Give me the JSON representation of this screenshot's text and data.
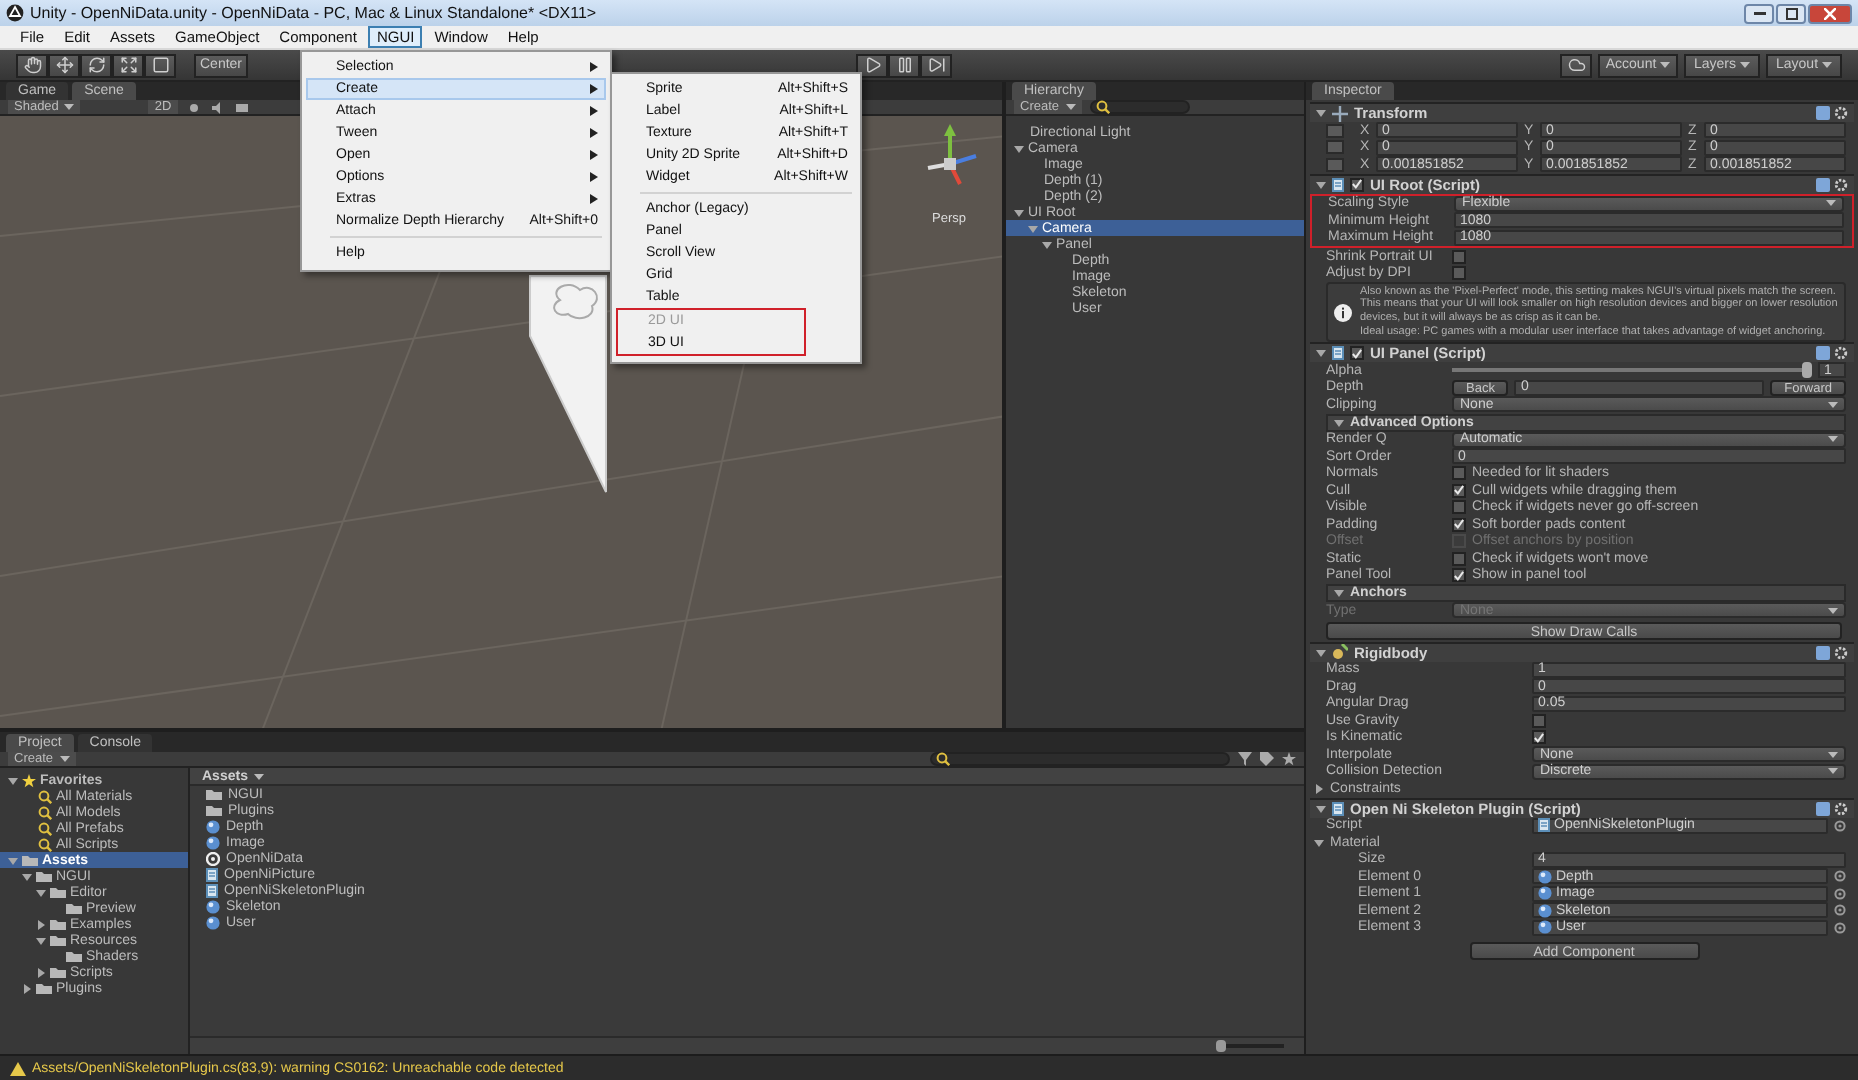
{
  "window": {
    "title": "Unity - OpenNiData.unity - OpenNiData - PC, Mac & Linux Standalone* <DX11>"
  },
  "menubar": [
    {
      "label": "File",
      "selected": false
    },
    {
      "label": "Edit",
      "selected": false
    },
    {
      "label": "Assets",
      "selected": false
    },
    {
      "label": "GameObject",
      "selected": false
    },
    {
      "label": "Component",
      "selected": false
    },
    {
      "label": "NGUI",
      "selected": true
    },
    {
      "label": "Window",
      "selected": false
    },
    {
      "label": "Help",
      "selected": false
    }
  ],
  "ngui_menu": {
    "items": [
      {
        "kind": "item",
        "label": "Selection",
        "submenu": true,
        "selected": false
      },
      {
        "kind": "item",
        "label": "Create",
        "submenu": true,
        "selected": true
      },
      {
        "kind": "item",
        "label": "Attach",
        "submenu": true,
        "selected": false
      },
      {
        "kind": "item",
        "label": "Tween",
        "submenu": true,
        "selected": false
      },
      {
        "kind": "item",
        "label": "Open",
        "submenu": true,
        "selected": false
      },
      {
        "kind": "item",
        "label": "Options",
        "submenu": true,
        "selected": false
      },
      {
        "kind": "item",
        "label": "Extras",
        "submenu": true,
        "selected": false
      },
      {
        "kind": "item",
        "label": "Normalize Depth Hierarchy",
        "shortcut": "Alt+Shift+0",
        "submenu": false,
        "selected": false
      },
      {
        "kind": "separator"
      },
      {
        "kind": "item",
        "label": "Help",
        "submenu": false,
        "selected": false
      }
    ]
  },
  "create_submenu": {
    "items": [
      {
        "kind": "item",
        "label": "Sprite",
        "shortcut": "Alt+Shift+S",
        "disabled": false,
        "marked": false
      },
      {
        "kind": "item",
        "label": "Label",
        "shortcut": "Alt+Shift+L",
        "disabled": false,
        "marked": false
      },
      {
        "kind": "item",
        "label": "Texture",
        "shortcut": "Alt+Shift+T",
        "disabled": false,
        "marked": false
      },
      {
        "kind": "item",
        "label": "Unity 2D Sprite",
        "shortcut": "Alt+Shift+D",
        "disabled": false,
        "marked": false
      },
      {
        "kind": "item",
        "label": "Widget",
        "shortcut": "Alt+Shift+W",
        "disabled": false,
        "marked": false
      },
      {
        "kind": "separator"
      },
      {
        "kind": "item",
        "label": "Anchor (Legacy)",
        "disabled": false,
        "marked": false
      },
      {
        "kind": "item",
        "label": "Panel",
        "disabled": false,
        "marked": false
      },
      {
        "kind": "item",
        "label": "Scroll View",
        "disabled": false,
        "marked": false
      },
      {
        "kind": "item",
        "label": "Grid",
        "disabled": false,
        "marked": false
      },
      {
        "kind": "item",
        "label": "Table",
        "disabled": false,
        "marked": false
      },
      {
        "kind": "item",
        "label": "2D UI",
        "disabled": true,
        "marked": true
      },
      {
        "kind": "item",
        "label": "3D UI",
        "disabled": false,
        "marked": true
      }
    ]
  },
  "toolbar": {
    "pivot": "Center",
    "account": "Account",
    "layers": "Layers",
    "layout": "Layout"
  },
  "scene_panel": {
    "tabs": [
      {
        "label": "Game",
        "selected": false
      },
      {
        "label": "Scene",
        "selected": true
      }
    ],
    "shading": "Shaded",
    "mode": "2D",
    "gizmo_label": "Persp"
  },
  "hierarchy": {
    "title": "Hierarchy",
    "create": "Create",
    "items": [
      {
        "label": "Directional Light",
        "selected": false
      },
      {
        "label": "Camera",
        "selected": false,
        "expanded": true,
        "children": [
          {
            "label": "Image",
            "selected": false
          },
          {
            "label": "Depth (1)",
            "selected": false
          },
          {
            "label": "Depth (2)",
            "selected": false
          }
        ]
      },
      {
        "label": "UI Root",
        "selected": false,
        "expanded": true,
        "children": [
          {
            "label": "Camera",
            "selected": true,
            "expanded": true,
            "children": [
              {
                "label": "Panel",
                "selected": false,
                "expanded": true,
                "children": [
                  {
                    "label": "Depth",
                    "selected": false
                  },
                  {
                    "label": "Image",
                    "selected": false
                  },
                  {
                    "label": "Skeleton",
                    "selected": false
                  },
                  {
                    "label": "User",
                    "selected": false
                  }
                ]
              }
            ]
          }
        ]
      }
    ]
  },
  "project": {
    "tabs": [
      {
        "label": "Project",
        "selected": true
      },
      {
        "label": "Console",
        "selected": false
      }
    ],
    "create": "Create",
    "tree": [
      {
        "kind": "favorites",
        "label": "Favorites",
        "selected": false,
        "expanded": true,
        "children": [
          {
            "kind": "search",
            "label": "All Materials",
            "selected": false
          },
          {
            "kind": "search",
            "label": "All Models",
            "selected": false
          },
          {
            "kind": "search",
            "label": "All Prefabs",
            "selected": false
          },
          {
            "kind": "search",
            "label": "All Scripts",
            "selected": false
          }
        ]
      },
      {
        "kind": "folder",
        "label": "Assets",
        "selected": true,
        "expanded": true,
        "children": [
          {
            "kind": "folder",
            "label": "NGUI",
            "selected": false,
            "expanded": true,
            "children": [
              {
                "kind": "folder",
                "label": "Editor",
                "selected": false,
                "expanded": true,
                "children": [
                  {
                    "kind": "folder",
                    "label": "Preview",
                    "selected": false
                  }
                ]
              },
              {
                "kind": "folder",
                "label": "Examples",
                "selected": false,
                "expanded": false
              },
              {
                "kind": "folder",
                "label": "Resources",
                "selected": false,
                "expanded": true,
                "children": [
                  {
                    "kind": "folder",
                    "label": "Shaders",
                    "selected": false
                  }
                ]
              },
              {
                "kind": "folder",
                "label": "Scripts",
                "selected": false,
                "expanded": false
              }
            ]
          },
          {
            "kind": "folder",
            "label": "Plugins",
            "selected": false,
            "expanded": false
          }
        ]
      }
    ],
    "breadcrumb": "Assets",
    "files": [
      {
        "kind": "folder",
        "label": "NGUI"
      },
      {
        "kind": "folder",
        "label": "Plugins"
      },
      {
        "kind": "material",
        "label": "Depth"
      },
      {
        "kind": "material",
        "label": "Image"
      },
      {
        "kind": "scene",
        "label": "OpenNiData"
      },
      {
        "kind": "script",
        "label": "OpenNiPicture"
      },
      {
        "kind": "script",
        "label": "OpenNiSkeletonPlugin"
      },
      {
        "kind": "material",
        "label": "Skeleton"
      },
      {
        "kind": "material",
        "label": "User"
      }
    ],
    "icon_slider": {
      "level": 0
    }
  },
  "inspector": {
    "title": "Inspector",
    "add_component": "Add Component",
    "components": [
      {
        "kind": "transform",
        "title": "Transform",
        "expanded": true,
        "rows": [
          {
            "kind": "vector",
            "cells": [
              {
                "axis": "X",
                "value": "0"
              },
              {
                "axis": "Y",
                "value": "0"
              },
              {
                "axis": "Z",
                "value": "0"
              }
            ]
          },
          {
            "kind": "vector",
            "cells": [
              {
                "axis": "X",
                "value": "0"
              },
              {
                "axis": "Y",
                "value": "0"
              },
              {
                "axis": "Z",
                "value": "0"
              }
            ]
          },
          {
            "kind": "vector",
            "cells": [
              {
                "axis": "X",
                "value": "0.001851852"
              },
              {
                "axis": "Y",
                "value": "0.001851852"
              },
              {
                "axis": "Z",
                "value": "0.001851852"
              }
            ]
          }
        ]
      },
      {
        "kind": "ngui_script",
        "title": "UI Root (Script)",
        "expanded": true,
        "enabled": true,
        "rows": [
          {
            "kind": "dropdown",
            "label": "Scaling Style",
            "value": "Flexible",
            "disabled": false,
            "marked": true
          },
          {
            "kind": "field",
            "label": "Minimum Height",
            "value": "1080",
            "marked": true
          },
          {
            "kind": "field",
            "label": "Maximum Height",
            "value": "1080",
            "marked": true
          },
          {
            "kind": "checkbox",
            "label": "Shrink Portrait UI",
            "checked": false,
            "disabled": false,
            "marked": false
          },
          {
            "kind": "checkbox",
            "label": "Adjust by DPI",
            "checked": false,
            "disabled": false,
            "marked": false
          },
          {
            "kind": "info",
            "paragraphs": [
              "Also known as the 'Pixel-Perfect' mode, this setting makes NGUI's virtual pixels match the screen. This means that your UI will look smaller on high resolution devices and bigger on lower resolution devices, but it will always be as crisp as it can be.",
              "Ideal usage: PC games with a modular user interface that takes advantage of widget anchoring."
            ],
            "marked": false
          }
        ]
      },
      {
        "kind": "ngui_script",
        "title": "UI Panel (Script)",
        "expanded": true,
        "enabled": true,
        "rows": [
          {
            "kind": "slider",
            "label": "Alpha",
            "value": "1",
            "level": 1
          },
          {
            "kind": "depth",
            "label": "Depth",
            "back": "Back",
            "value": "0",
            "forward": "Forward"
          },
          {
            "kind": "dropdown",
            "label": "Clipping",
            "value": "None",
            "disabled": false
          },
          {
            "kind": "subheader",
            "label": "Advanced Options",
            "expanded": true
          },
          {
            "kind": "dropdown",
            "label": "Render Q",
            "value": "Automatic",
            "disabled": false
          },
          {
            "kind": "field",
            "label": "Sort Order",
            "value": "0"
          },
          {
            "kind": "checkbox",
            "label": "Normals",
            "checked": false,
            "disabled": false,
            "note": "Needed for lit shaders"
          },
          {
            "kind": "checkbox",
            "label": "Cull",
            "checked": true,
            "disabled": false,
            "note": "Cull widgets while dragging them"
          },
          {
            "kind": "checkbox",
            "label": "Visible",
            "checked": false,
            "disabled": false,
            "note": "Check if widgets never go off-screen"
          },
          {
            "kind": "checkbox",
            "label": "Padding",
            "checked": true,
            "disabled": false,
            "note": "Soft border pads content"
          },
          {
            "kind": "checkbox",
            "label": "Offset",
            "checked": false,
            "disabled": true,
            "note": "Offset anchors by position"
          },
          {
            "kind": "checkbox",
            "label": "Static",
            "checked": false,
            "disabled": false,
            "note": "Check if widgets won't move"
          },
          {
            "kind": "checkbox",
            "label": "Panel Tool",
            "checked": true,
            "disabled": false,
            "note": "Show in panel tool"
          },
          {
            "kind": "subheader",
            "label": "Anchors",
            "expanded": true
          },
          {
            "kind": "dropdown",
            "label": "Type",
            "value": "None",
            "disabled": true
          },
          {
            "kind": "button",
            "label": "Show Draw Calls"
          }
        ]
      },
      {
        "kind": "rigidbody",
        "title": "Rigidbody",
        "expanded": true,
        "rows": [
          {
            "kind": "field",
            "label": "Mass",
            "value": "1"
          },
          {
            "kind": "field",
            "label": "Drag",
            "value": "0"
          },
          {
            "kind": "field",
            "label": "Angular Drag",
            "value": "0.05"
          },
          {
            "kind": "checkbox",
            "label": "Use Gravity",
            "checked": false,
            "disabled": false
          },
          {
            "kind": "checkbox",
            "label": "Is Kinematic",
            "checked": true,
            "disabled": false
          },
          {
            "kind": "dropdown",
            "label": "Interpolate",
            "value": "None",
            "disabled": false
          },
          {
            "kind": "dropdown",
            "label": "Collision Detection",
            "value": "Discrete",
            "disabled": false
          },
          {
            "kind": "foldout",
            "label": "Constraints",
            "expanded": false
          }
        ]
      },
      {
        "kind": "script",
        "title": "Open Ni Skeleton Plugin (Script)",
        "expanded": true,
        "rows": [
          {
            "kind": "script_object",
            "label": "Script",
            "value": "OpenNiSkeletonPlugin"
          },
          {
            "kind": "foldout",
            "label": "Material",
            "expanded": true,
            "children": [
              {
                "kind": "field",
                "label": "Size",
                "value": "4"
              },
              {
                "kind": "material_object",
                "label": "Element 0",
                "value": "Depth"
              },
              {
                "kind": "material_object",
                "label": "Element 1",
                "value": "Image"
              },
              {
                "kind": "material_object",
                "label": "Element 2",
                "value": "Skeleton"
              },
              {
                "kind": "material_object",
                "label": "Element 3",
                "value": "User"
              }
            ]
          }
        ]
      }
    ]
  },
  "status_bar": {
    "kind": "warning",
    "message": "Assets/OpenNiSkeletonPlugin.cs(83,9): warning CS0162: Unreachable code detected"
  }
}
